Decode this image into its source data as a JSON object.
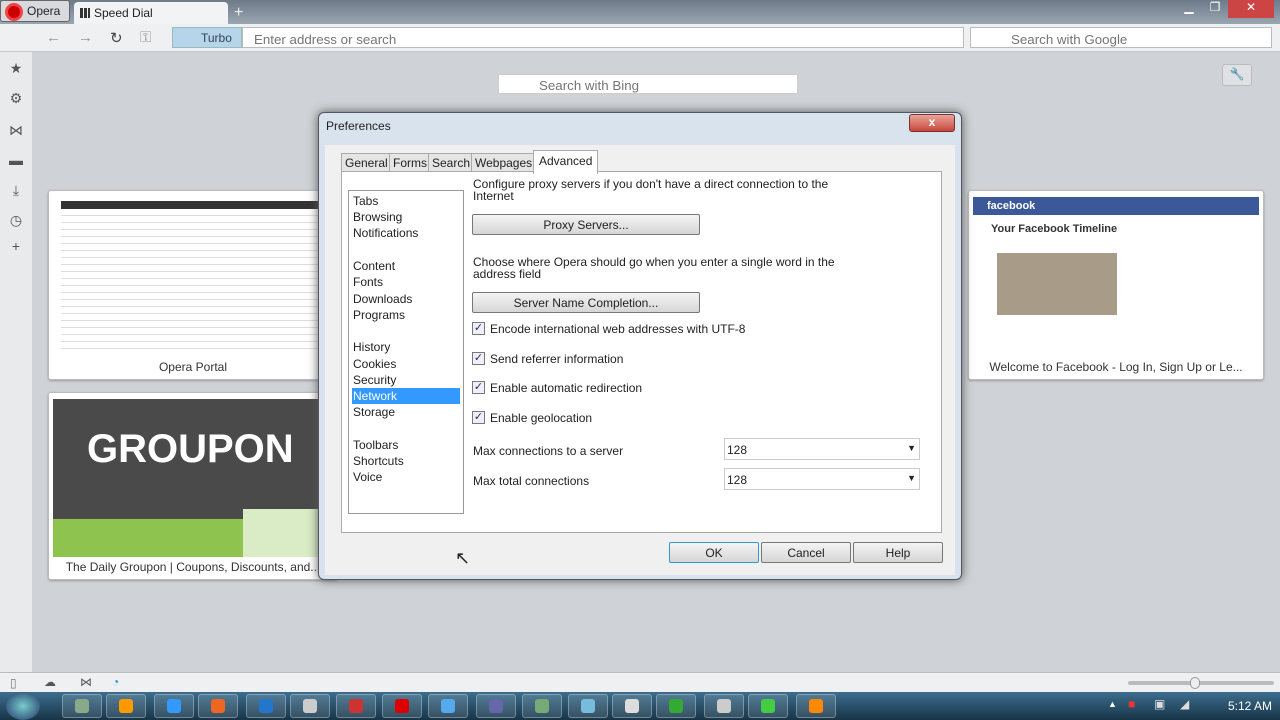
{
  "browser": {
    "menu_label": "Opera",
    "tab_label": "Speed Dial",
    "turbo_label": "Turbo",
    "address_placeholder": "Enter address or search",
    "search_placeholder": "Search with Google"
  },
  "speed_dial": {
    "search_placeholder": "Search with Bing",
    "tiles": [
      {
        "caption": "Opera Portal"
      },
      {
        "caption": "The Daily Groupon | Coupons, Discounts, and..."
      },
      {
        "caption": "Welcome to Facebook - Log In, Sign Up or Le..."
      }
    ],
    "groupon_logo": "GROUPON",
    "facebook_logo": "facebook",
    "facebook_heading": "Your Facebook Timeline"
  },
  "dialog": {
    "title": "Preferences",
    "tabs": [
      "General",
      "Forms",
      "Search",
      "Webpages",
      "Advanced"
    ],
    "active_tab": "Advanced",
    "categories": [
      [
        "Tabs",
        "Browsing",
        "Notifications"
      ],
      [
        "Content",
        "Fonts",
        "Downloads",
        "Programs"
      ],
      [
        "History",
        "Cookies",
        "Security",
        "Network",
        "Storage"
      ],
      [
        "Toolbars",
        "Shortcuts",
        "Voice"
      ]
    ],
    "selected_category": "Network",
    "proxy_text": "Configure proxy servers if you don't have a direct connection to the Internet",
    "proxy_button": "Proxy Servers...",
    "server_text": "Choose where Opera should go when you enter a single word in the address field",
    "server_button": "Server Name Completion...",
    "checkboxes": [
      {
        "label": "Encode international web addresses with UTF-8",
        "checked": true
      },
      {
        "label": "Send referrer information",
        "checked": true
      },
      {
        "label": "Enable automatic redirection",
        "checked": true
      },
      {
        "label": "Enable geolocation",
        "checked": true
      }
    ],
    "max_server_label": "Max connections to a server",
    "max_server_value": "128",
    "max_total_label": "Max total connections",
    "max_total_value": "128",
    "ok": "OK",
    "cancel": "Cancel",
    "help": "Help"
  },
  "taskbar": {
    "clock": "5:12 AM"
  }
}
